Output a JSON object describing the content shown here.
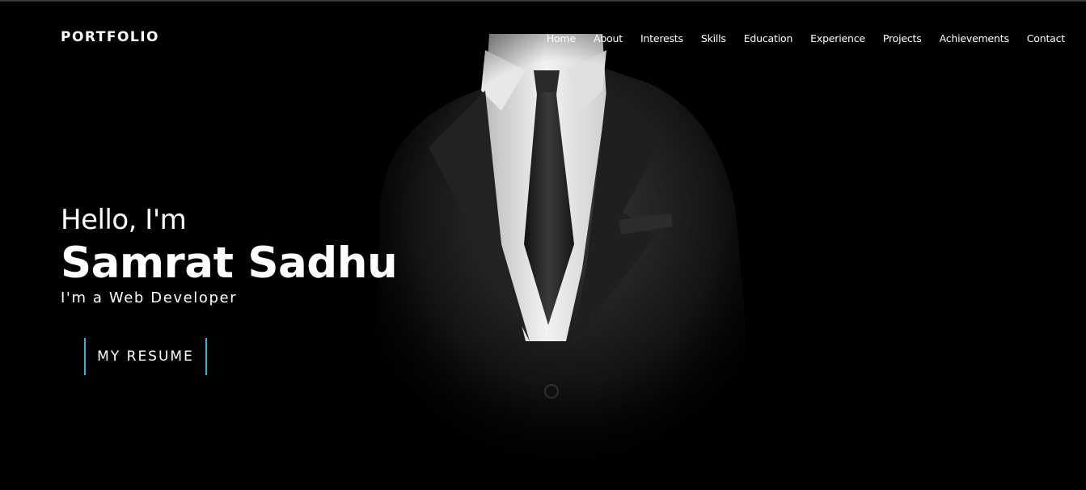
{
  "brand": {
    "logo_text": "PORTFOLIO"
  },
  "nav": {
    "items": [
      {
        "label": "Home"
      },
      {
        "label": "About"
      },
      {
        "label": "Interests"
      },
      {
        "label": "Skills"
      },
      {
        "label": "Education"
      },
      {
        "label": "Experience"
      },
      {
        "label": "Projects"
      },
      {
        "label": "Achievements"
      },
      {
        "label": "Contact"
      }
    ]
  },
  "hero": {
    "greeting": "Hello, I'm",
    "name": "Samrat Sadhu",
    "role": "I'm a Web Developer",
    "resume_label": "MY RESUME"
  },
  "colors": {
    "background": "#000000",
    "text": "#ffffff",
    "accent": "#29b6d8"
  }
}
